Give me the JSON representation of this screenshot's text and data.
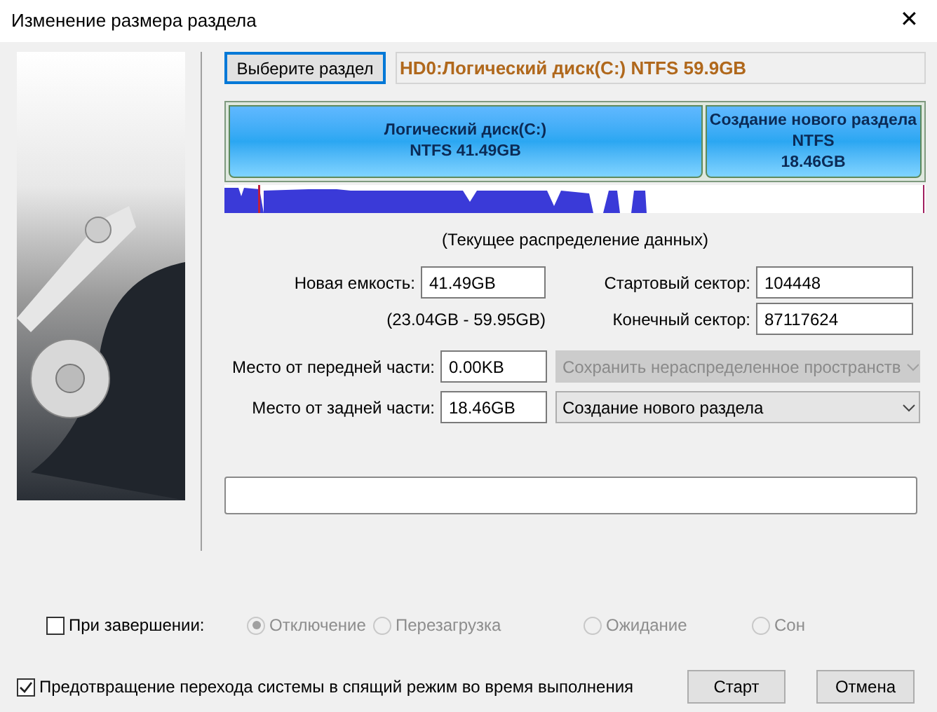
{
  "window": {
    "title": "Изменение размера раздела",
    "close": "✕"
  },
  "select_button": "Выберите раздел",
  "partition_label": "HD0:Логический диск(C:) NTFS 59.9GB",
  "partitions": [
    {
      "lines": [
        "Логический диск(C:)",
        "NTFS 41.49GB"
      ],
      "level": 0.686
    },
    {
      "lines": [
        "Создание нового раздела",
        "NTFS",
        "18.46GB"
      ],
      "level": 0.314
    }
  ],
  "distribution_caption": "(Текущее распределение данных)",
  "new_capacity": {
    "label": "Новая емкость:",
    "value": "41.49GB",
    "range": "(23.04GB - 59.95GB)"
  },
  "start_sector": {
    "label": "Стартовый сектор:",
    "value": "104448"
  },
  "end_sector": {
    "label": "Конечный сектор:",
    "value": "87117624"
  },
  "front_space": {
    "label": "Место от передней части:",
    "value": "0.00KB",
    "dropdown": "Сохранить нераспределенное пространств",
    "disabled": true
  },
  "back_space": {
    "label": "Место от задней части:",
    "value": "18.46GB",
    "dropdown": "Создание нового раздела",
    "disabled": false
  },
  "progress": {
    "level": 0
  },
  "on_finish": {
    "label": "При завершении:",
    "checked": false,
    "options": [
      {
        "label": "Отключение",
        "selected": true,
        "disabled": true
      },
      {
        "label": "Перезагрузка",
        "selected": false,
        "disabled": true
      },
      {
        "label": "Ожидание",
        "selected": false,
        "disabled": true
      },
      {
        "label": "Сон",
        "selected": false,
        "disabled": true
      }
    ]
  },
  "prevent_sleep": {
    "label": "Предотвращение перехода системы в спящий режим во время выполнения",
    "checked": true
  },
  "buttons": [
    "Старт",
    "Отмена"
  ]
}
